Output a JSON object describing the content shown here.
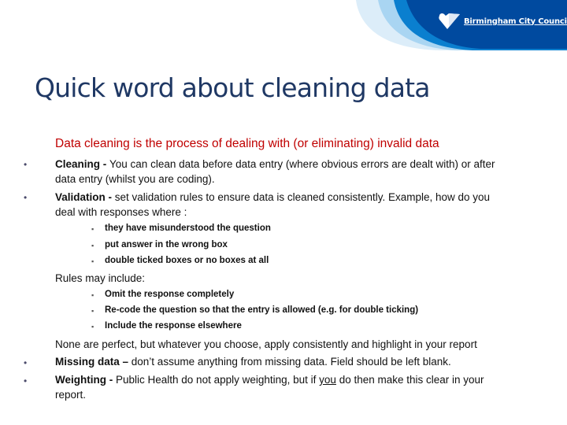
{
  "header": {
    "organization": "Birmingham City Council",
    "colors": {
      "dark_blue": "#004a9f",
      "mid_blue": "#0a7fcf",
      "light_blue": "#a9d5f2",
      "pale_blue": "#dcedf9"
    }
  },
  "slide": {
    "title": "Quick word about cleaning data",
    "intro": "Data cleaning is the process of dealing with (or eliminating) invalid data",
    "bullets": [
      {
        "bold": "Cleaning - ",
        "text_line1": "You can clean data before data entry (where obvious errors are dealt with) or after",
        "text_line2": "data entry (whilst you are coding)."
      },
      {
        "bold": "Validation - ",
        "text_line1": "set validation rules to ensure data is cleaned consistently. Example, how do you",
        "text_line2": "deal with responses where :"
      }
    ],
    "validation_cases": [
      "they have misunderstood the question",
      "put answer in the wrong box",
      "double ticked boxes or no boxes at all"
    ],
    "rules_heading": "Rules may include:",
    "rules": [
      "Omit the response completely",
      "Re-code the question so that the entry is allowed (e.g. for double ticking)",
      "Include the response elsewhere"
    ],
    "none_perfect": "None are perfect, but whatever you choose, apply consistently and highlight in your report",
    "missing": {
      "bold": "Missing data – ",
      "text": "don’t assume anything from missing data. Field should be left blank."
    },
    "weighting": {
      "bold": "Weighting  - ",
      "text_before": "Public Health do not apply weighting, but if ",
      "underlined": "you",
      "text_after": " do then make this clear in your",
      "text_line2": "report."
    },
    "colors": {
      "title": "#1f3864",
      "intro": "#c00000"
    }
  }
}
